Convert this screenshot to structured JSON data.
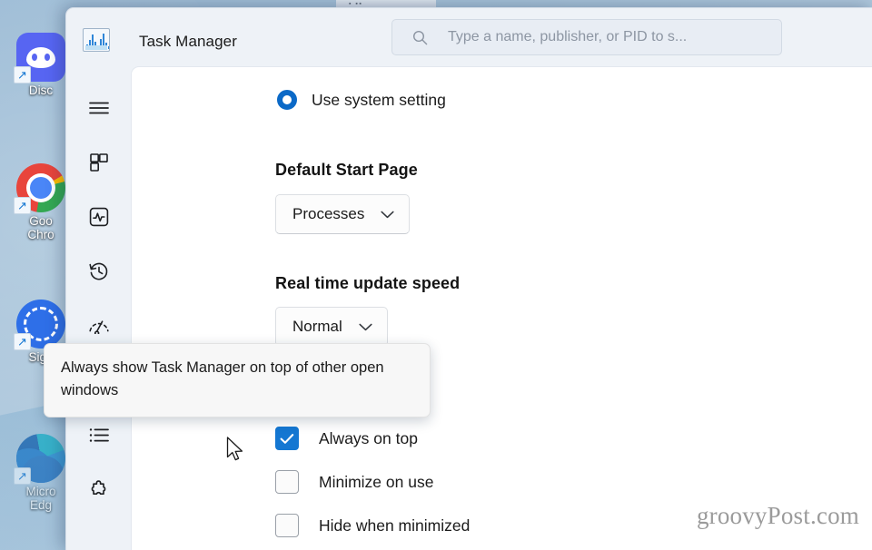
{
  "desktop": {
    "icons": [
      {
        "name": "Discord",
        "label_lines": [
          "Disc"
        ],
        "art": "discord"
      },
      {
        "name": "Google Chrome",
        "label_lines": [
          "Goo",
          "Chro"
        ],
        "art": "chrome"
      },
      {
        "name": "Signal",
        "label_lines": [
          "Sign"
        ],
        "art": "signal"
      },
      {
        "name": "Microsoft Edge",
        "label_lines": [
          "Micro",
          "Edg"
        ],
        "art": "edge"
      }
    ],
    "watermark": "groovyPost.com"
  },
  "window": {
    "title": "Task Manager",
    "app_icon": "task-manager-icon"
  },
  "search": {
    "placeholder": "Type a name, publisher, or PID to s...",
    "value": "",
    "icon": "search-icon"
  },
  "sidebar": {
    "items": [
      {
        "icon": "hamburger-menu-icon",
        "name": "menu"
      },
      {
        "icon": "processes-icon",
        "name": "processes"
      },
      {
        "icon": "performance-icon",
        "name": "performance"
      },
      {
        "icon": "app-history-icon",
        "name": "app-history"
      },
      {
        "icon": "startup-apps-icon",
        "name": "startup-apps"
      },
      {
        "icon": "details-icon",
        "name": "details"
      },
      {
        "icon": "services-icon",
        "name": "services"
      }
    ]
  },
  "settings": {
    "app_theme": {
      "option_label": "Use system setting",
      "checked": true
    },
    "default_start_page": {
      "title": "Default Start Page",
      "value": "Processes"
    },
    "update_speed": {
      "title": "Real time update speed",
      "value": "Normal"
    },
    "window_management": {
      "checkboxes": [
        {
          "label": "Always on top",
          "checked": true
        },
        {
          "label": "Minimize on use",
          "checked": false
        },
        {
          "label": "Hide when minimized",
          "checked": false
        }
      ]
    }
  },
  "tooltip": {
    "text": "Always show Task Manager on top of other open windows"
  },
  "colors": {
    "accent": "#1477d2",
    "radio_accent": "#0b69c7",
    "window_chrome": "#eef2f7",
    "content_bg": "#ffffff",
    "desktop": "#a8c4da"
  }
}
